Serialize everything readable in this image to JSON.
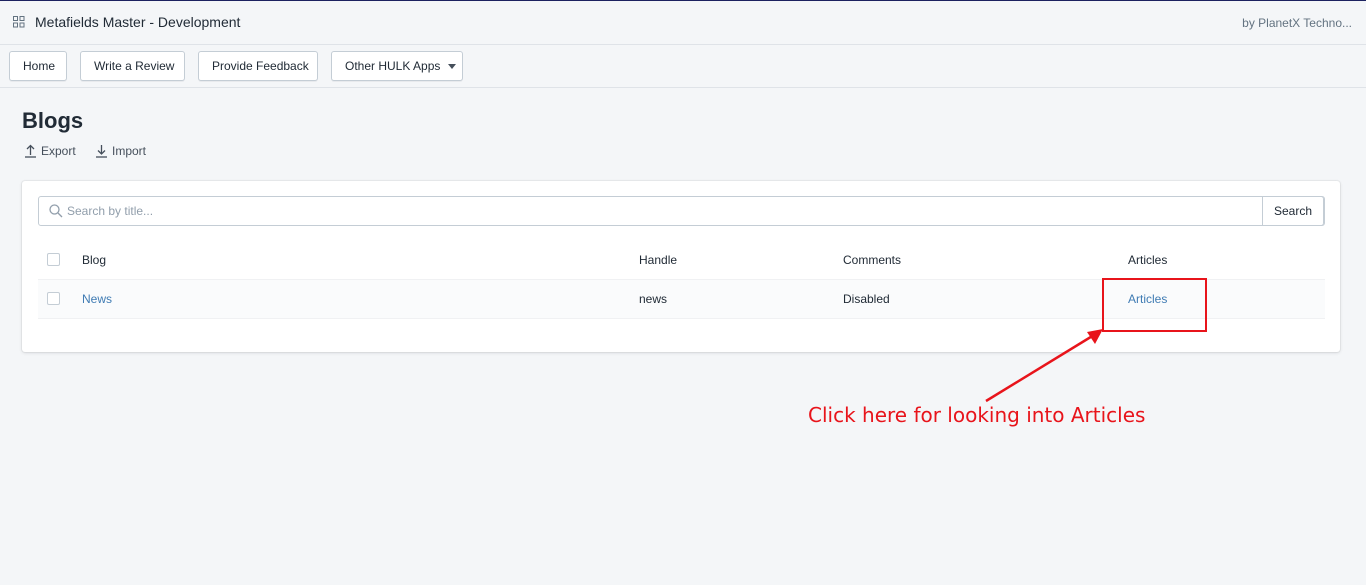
{
  "app": {
    "title": "Metafields Master - Development",
    "by_line": "by PlanetX Techno..."
  },
  "nav": {
    "home": "Home",
    "write_review": "Write a Review",
    "feedback": "Provide Feedback",
    "other_apps": "Other HULK Apps"
  },
  "page": {
    "title": "Blogs",
    "export": "Export",
    "import": "Import"
  },
  "search": {
    "placeholder": "Search by title...",
    "value": "",
    "button": "Search"
  },
  "table": {
    "headers": {
      "blog": "Blog",
      "handle": "Handle",
      "comments": "Comments",
      "articles": "Articles"
    },
    "rows": [
      {
        "blog": "News",
        "handle": "news",
        "comments": "Disabled",
        "articles": "Articles"
      }
    ]
  },
  "annotation": {
    "text": "Click here for looking into Articles",
    "color": "#e8141b"
  },
  "colors": {
    "link": "#3f7bb3",
    "background": "#f4f6f8",
    "header_border": "#1c2260"
  }
}
